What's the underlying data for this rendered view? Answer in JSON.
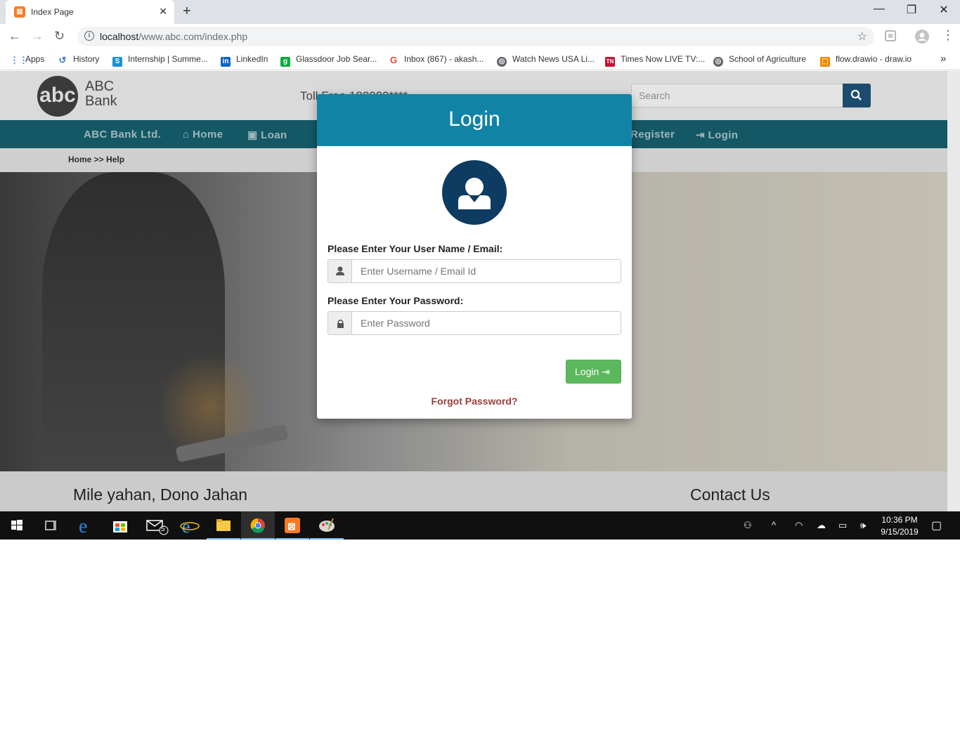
{
  "browser": {
    "tab_title": "Index Page",
    "url_host": "localhost",
    "url_path": "/www.abc.com/index.php",
    "bookmarks": [
      {
        "label": "Apps",
        "icon": "apps-grid-icon"
      },
      {
        "label": "History",
        "icon": "history-icon"
      },
      {
        "label": "Internship | Summe...",
        "icon": "internshala-icon"
      },
      {
        "label": "LinkedIn",
        "icon": "linkedin-icon"
      },
      {
        "label": "Glassdoor Job Sear...",
        "icon": "glassdoor-icon"
      },
      {
        "label": "Inbox (867) - akash...",
        "icon": "google-icon"
      },
      {
        "label": "Watch News USA Li...",
        "icon": "globe-icon"
      },
      {
        "label": "Times Now LIVE TV:...",
        "icon": "times-now-icon"
      },
      {
        "label": "School of Agriculture",
        "icon": "globe-icon"
      },
      {
        "label": "flow.drawio - draw.io",
        "icon": "drawio-icon"
      }
    ]
  },
  "site": {
    "logo_mark": "abc",
    "logo_line1": "ABC",
    "logo_line2": "Bank",
    "toll_free": "Toll Free 180000****",
    "search_placeholder": "Search",
    "nav": {
      "brand": "ABC Bank Ltd.",
      "home": "Home",
      "loan": "Loan",
      "register": "Register",
      "login": "Login"
    },
    "breadcrumb": "Home >> Help",
    "footer_left": "Mile yahan, Dono Jahan",
    "footer_right": "Contact Us"
  },
  "modal": {
    "title": "Login",
    "username_label": "Please Enter Your User Name / Email:",
    "username_placeholder": "Enter Username / Email Id",
    "password_label": "Please Enter Your Password:",
    "password_placeholder": "Enter Password",
    "login_button": "Login",
    "forgot_link": "Forgot Password?"
  },
  "taskbar": {
    "mail_badge": "5",
    "time": "10:36 PM",
    "date": "9/15/2019"
  },
  "colors": {
    "modal_header": "#1184a6",
    "navbar": "#145866",
    "login_button": "#5cb85c",
    "forgot_link": "#9c3c3c",
    "avatar": "#0d3b62"
  }
}
